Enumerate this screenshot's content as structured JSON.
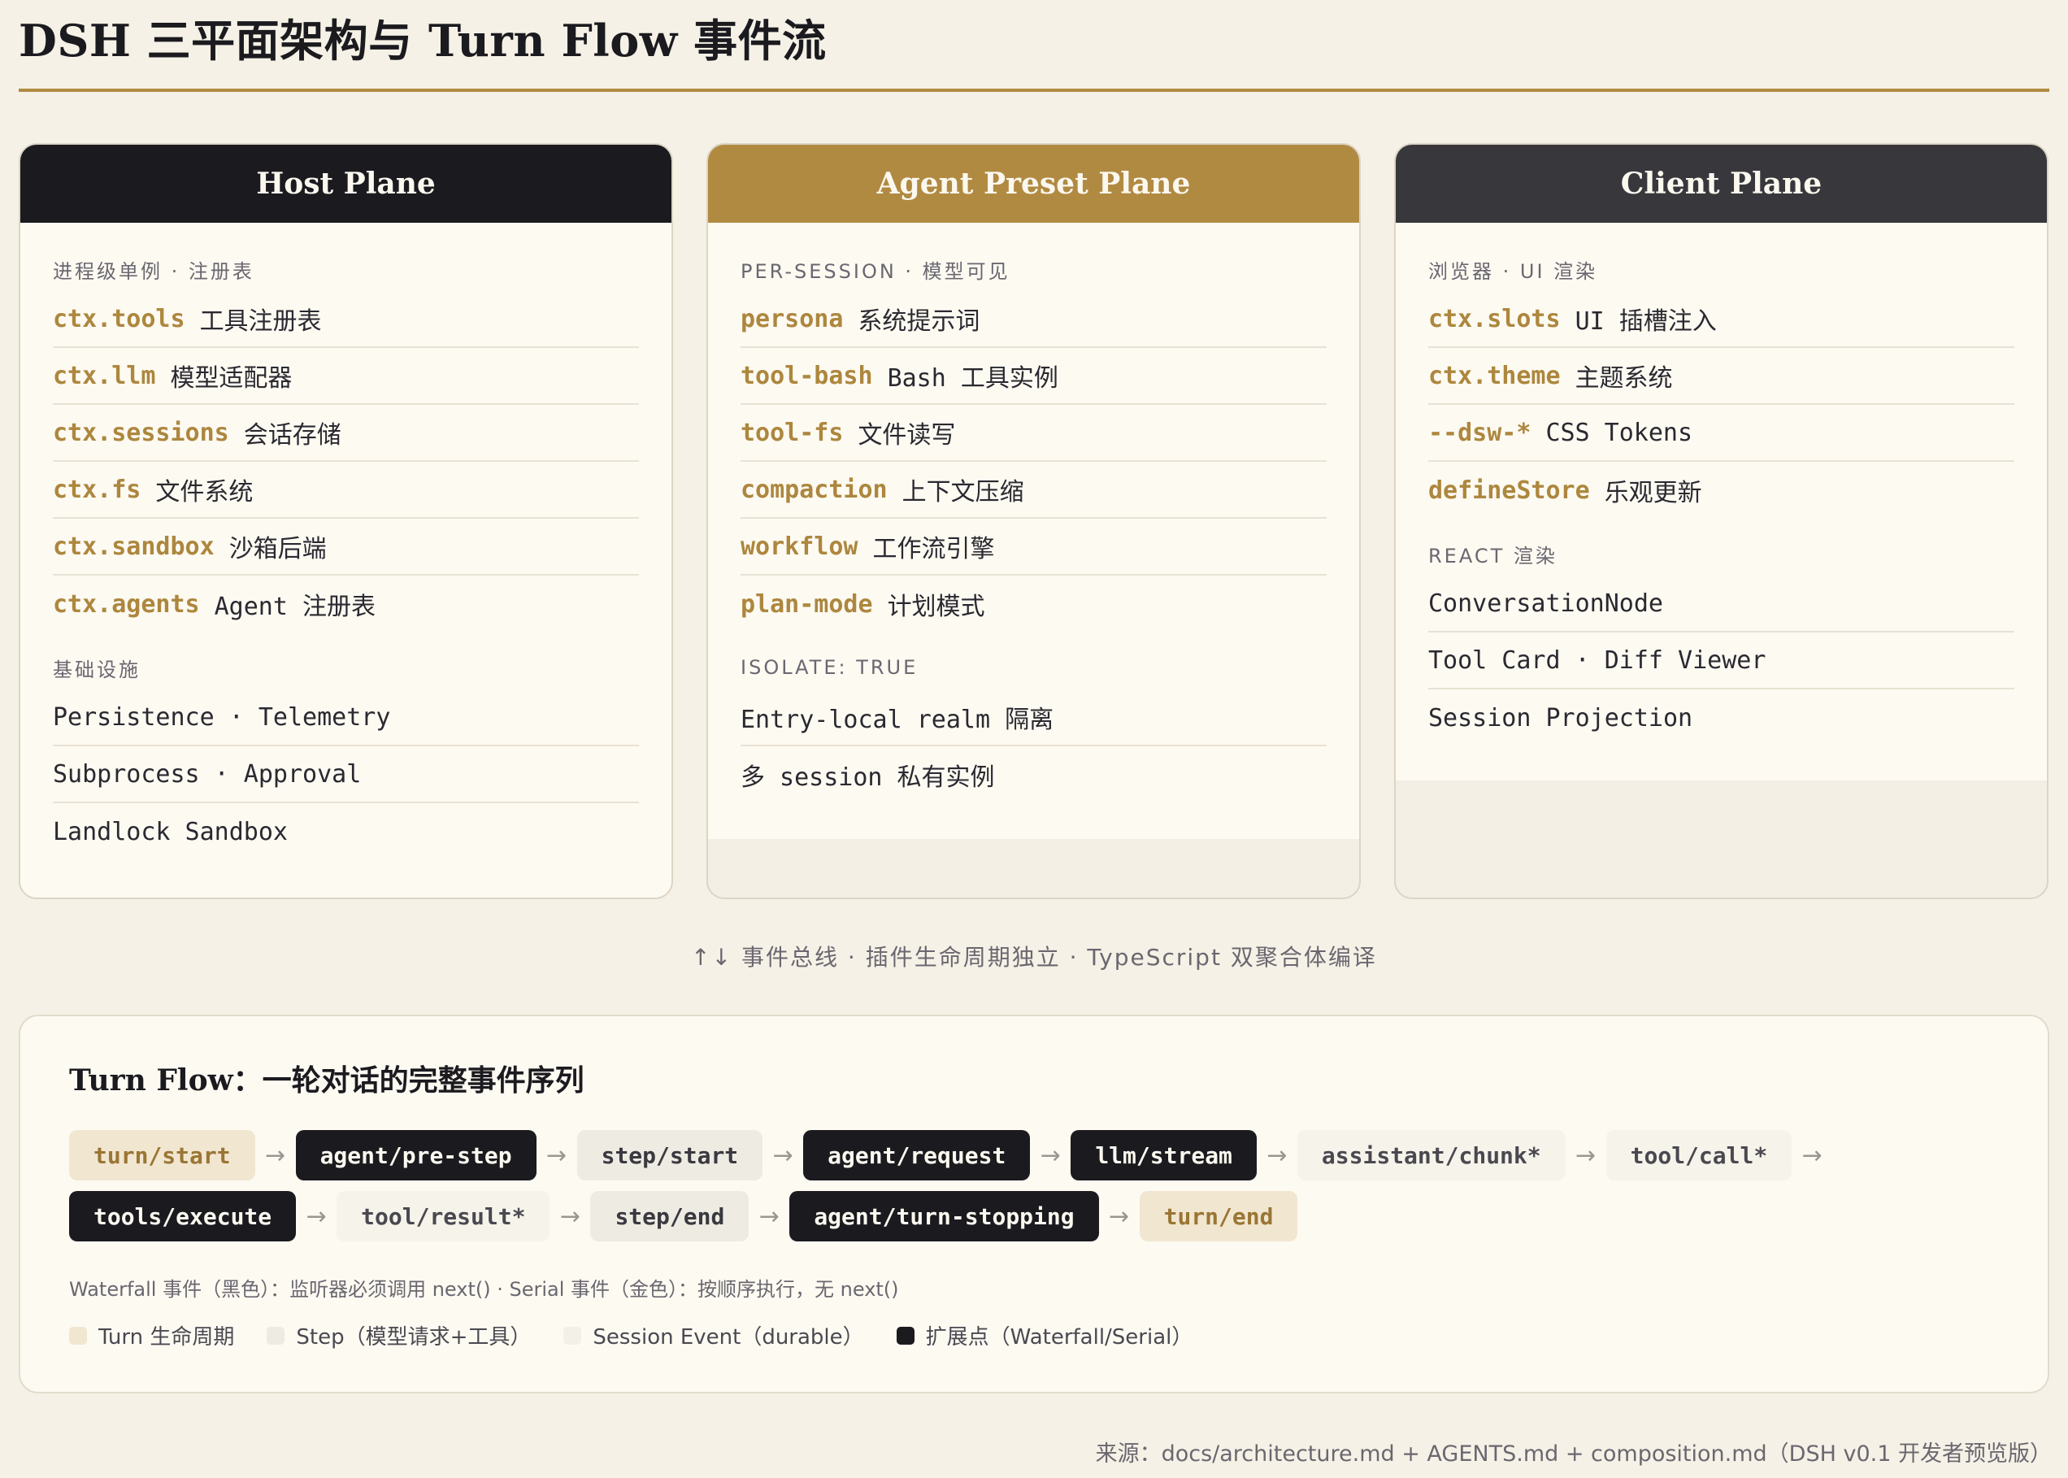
{
  "title": "DSH 三平面架构与 Turn Flow 事件流",
  "colors": {
    "accent": "#b18a42",
    "dark": "#1b1a1f",
    "charcoal": "#38373c",
    "background": "#f5f1e6"
  },
  "planes": [
    {
      "name": "Host Plane",
      "sections": [
        {
          "label": "进程级单例 · 注册表",
          "items": [
            {
              "key": "ctx.tools",
              "desc": "工具注册表"
            },
            {
              "key": "ctx.llm",
              "desc": "模型适配器"
            },
            {
              "key": "ctx.sessions",
              "desc": "会话存储"
            },
            {
              "key": "ctx.fs",
              "desc": "文件系统"
            },
            {
              "key": "ctx.sandbox",
              "desc": "沙箱后端"
            },
            {
              "key": "ctx.agents",
              "desc": "Agent 注册表"
            }
          ]
        },
        {
          "label": "基础设施",
          "items": [
            {
              "text": "Persistence · Telemetry"
            },
            {
              "text": "Subprocess · Approval"
            },
            {
              "text": "Landlock Sandbox"
            }
          ]
        }
      ]
    },
    {
      "name": "Agent Preset Plane",
      "sections": [
        {
          "label": "PER-SESSION · 模型可见",
          "items": [
            {
              "key": "persona",
              "desc": "系统提示词"
            },
            {
              "key": "tool-bash",
              "desc": "Bash 工具实例"
            },
            {
              "key": "tool-fs",
              "desc": "文件读写"
            },
            {
              "key": "compaction",
              "desc": "上下文压缩"
            },
            {
              "key": "workflow",
              "desc": "工作流引擎"
            },
            {
              "key": "plan-mode",
              "desc": "计划模式"
            }
          ]
        },
        {
          "label": "ISOLATE: TRUE",
          "items": [
            {
              "text": "Entry-local realm 隔离"
            },
            {
              "text": "多 session 私有实例"
            }
          ]
        }
      ]
    },
    {
      "name": "Client Plane",
      "sections": [
        {
          "label": "浏览器 · UI 渲染",
          "items": [
            {
              "key": "ctx.slots",
              "desc": "UI 插槽注入"
            },
            {
              "key": "ctx.theme",
              "desc": "主题系统"
            },
            {
              "key": "--dsw-*",
              "desc": "CSS Tokens"
            },
            {
              "key": "defineStore",
              "desc": "乐观更新"
            }
          ]
        },
        {
          "label": "REACT 渲染",
          "items": [
            {
              "text": "ConversationNode"
            },
            {
              "text": "Tool Card · Diff Viewer"
            },
            {
              "text": "Session Projection"
            }
          ]
        }
      ]
    }
  ],
  "bus": "↑↓ 事件总线 · 插件生命周期独立 · TypeScript 双聚合体编译",
  "flow": {
    "title": "Turn Flow：一轮对话的完整事件序列",
    "arrow": "→",
    "row1": [
      {
        "label": "turn/start",
        "kind": "turn"
      },
      {
        "label": "agent/pre-step",
        "kind": "ext"
      },
      {
        "label": "step/start",
        "kind": "step"
      },
      {
        "label": "agent/request",
        "kind": "ext"
      },
      {
        "label": "llm/stream",
        "kind": "ext"
      },
      {
        "label": "assistant/chunk*",
        "kind": "sess"
      },
      {
        "label": "tool/call*",
        "kind": "sess"
      }
    ],
    "row2": [
      {
        "label": "tools/execute",
        "kind": "ext"
      },
      {
        "label": "tool/result*",
        "kind": "sess"
      },
      {
        "label": "step/end",
        "kind": "step"
      },
      {
        "label": "agent/turn-stopping",
        "kind": "ext"
      },
      {
        "label": "turn/end",
        "kind": "turn"
      }
    ],
    "note": "Waterfall 事件（黑色）：监听器必须调用 next() · Serial 事件（金色）：按顺序执行，无 next()",
    "legend": [
      {
        "label": "Turn 生命周期",
        "kind": "turn"
      },
      {
        "label": "Step（模型请求+工具）",
        "kind": "step"
      },
      {
        "label": "Session Event（durable）",
        "kind": "sess"
      },
      {
        "label": "扩展点（Waterfall/Serial）",
        "kind": "ext"
      }
    ]
  },
  "source": "来源：docs/architecture.md + AGENTS.md + composition.md（DSH v0.1 开发者预览版）"
}
